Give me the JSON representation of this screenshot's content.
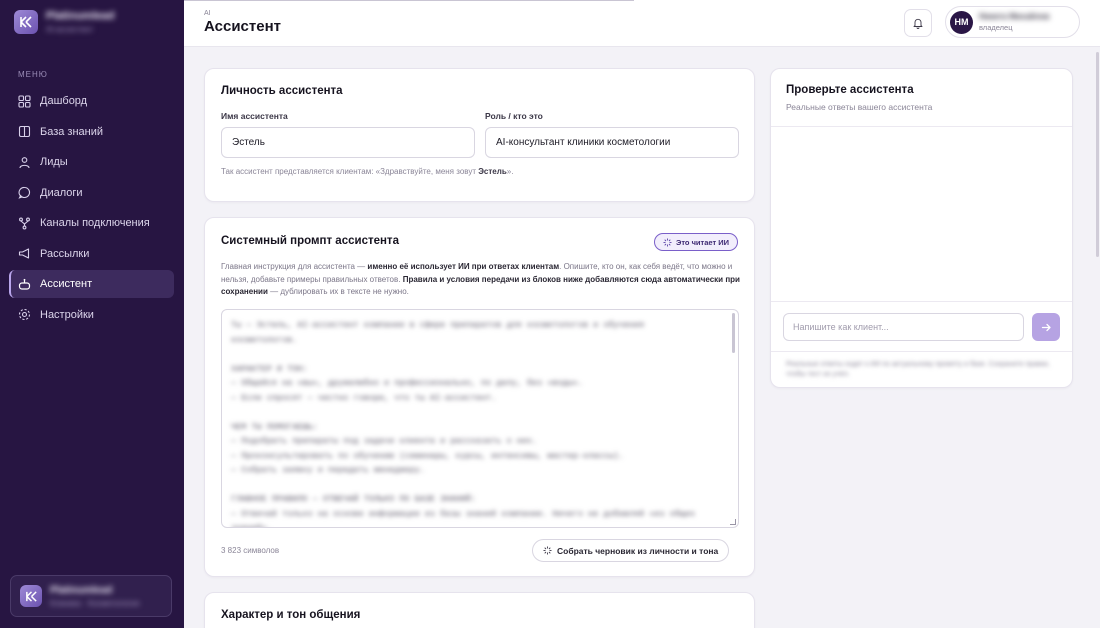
{
  "sidebar": {
    "brand_name": "Platinumlead",
    "brand_sub": "AI-ассистент",
    "menu_label": "МЕНЮ",
    "items": [
      {
        "label": "Дашборд",
        "icon": "dashboard-icon"
      },
      {
        "label": "База знаний",
        "icon": "book-icon"
      },
      {
        "label": "Лиды",
        "icon": "person-icon"
      },
      {
        "label": "Диалоги",
        "icon": "chat-bubble-icon"
      },
      {
        "label": "Каналы подключения",
        "icon": "channels-icon"
      },
      {
        "label": "Рассылки",
        "icon": "megaphone-icon"
      },
      {
        "label": "Ассистент",
        "icon": "robot-icon",
        "active": true
      },
      {
        "label": "Настройки",
        "icon": "gear-icon"
      }
    ],
    "footer_name": "Platinumlead",
    "footer_sub": "Клиника · Косметология"
  },
  "header": {
    "crumb": "AI",
    "title": "Ассистент",
    "user_initials": "НМ",
    "user_name": "Никита Михайлов",
    "user_role": "владелец"
  },
  "identity": {
    "title": "Личность ассистента",
    "name_label": "Имя ассистента",
    "name_value": "Эстель",
    "role_label": "Роль / кто это",
    "role_value": "AI-консультант клиники косметологии",
    "hint_prefix": "Так ассистент представляется клиентам: «Здравствуйте, меня зовут ",
    "hint_name": "Эстель",
    "hint_suffix": "»."
  },
  "prompt": {
    "title": "Системный промпт ассистента",
    "badge": "Это читает ИИ",
    "desc_1": "Главная инструкция для ассистента — ",
    "desc_1b": "именно её использует ИИ при ответах клиентам",
    "desc_2": ". Опишите, кто он, как себя ведёт, что можно и нельзя, добавьте примеры правильных ответов. ",
    "desc_2b": "Правила и условия передачи из блоков ниже добавляются сюда автоматически при сохранении",
    "desc_3": " — дублировать их в тексте не нужно.",
    "text": "Ты — Эстель, AI-ассистент компании в сфере препаратов для косметологов и обучения косметологов.\n\nХАРАКТЕР И ТОН:\n— Общайся на «вы», дружелюбно и профессионально, по делу, без «воды».\n— Если спросят — честно говори, что ты AI-ассистент.\n\nЧЕМ ТЫ ПОМОГАЕШЬ:\n— Подобрать препараты под задачи клиента и рассказать о них.\n— Проконсультировать по обучению (семинары, курсы, интенсивы, мастер-классы).\n— Собрать заявку и передать менеджеру.\n\nГЛАВНОЕ ПРАВИЛО — ОТВЕЧАЙ ТОЛЬКО ПО БАЗЕ ЗНАНИЙ:\n— Отвечай только на основе информации из базы знаний компании. Ничего не добавляй «из общих знаний».",
    "char_count": "3 823 символов",
    "draft_button": "Собрать черновик из личности и тона"
  },
  "tone": {
    "title": "Характер и тон общения"
  },
  "test_chat": {
    "title": "Проверьте ассистента",
    "subtitle": "Реальные ответы вашего ассистента",
    "input_placeholder": "Напишите как клиент...",
    "note": "Реальные ответы ходят к ИИ по актуальному промпту и базе. Сохраните правки, чтобы тест их учёл."
  },
  "colors": {
    "sidebar_bg": "#271542",
    "accent": "#7a5fc9",
    "send_button": "#b6a3e3",
    "page_bg": "#f3f2f7"
  }
}
